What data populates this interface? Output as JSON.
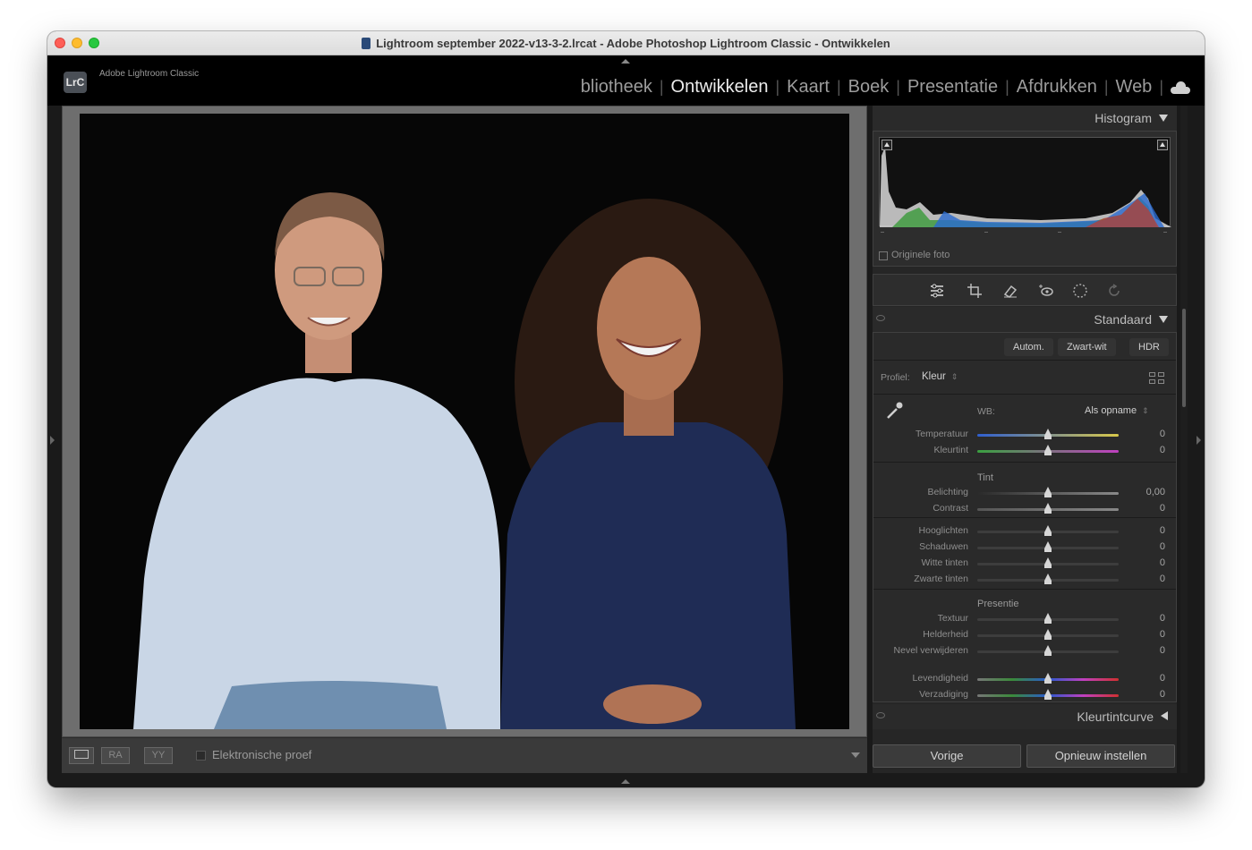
{
  "window": {
    "title": "Lightroom september 2022-v13-3-2.lrcat - Adobe Photoshop Lightroom Classic - Ontwikkelen"
  },
  "app": {
    "logo": "LrC",
    "name": "Adobe Lightroom Classic"
  },
  "modules": [
    {
      "label": "bliotheek",
      "active": false
    },
    {
      "label": "Ontwikkelen",
      "active": true
    },
    {
      "label": "Kaart",
      "active": false
    },
    {
      "label": "Boek",
      "active": false
    },
    {
      "label": "Presentatie",
      "active": false
    },
    {
      "label": "Afdrukken",
      "active": false
    },
    {
      "label": "Web",
      "active": false
    }
  ],
  "toolbar": {
    "view_btn_1": "RA",
    "view_btn_2": "YY",
    "soft_proof_label": "Elektronische proef"
  },
  "histogram": {
    "header": "Histogram",
    "original_photo_label": "Originele foto"
  },
  "basic": {
    "header": "Standaard",
    "buttons": [
      "Autom.",
      "Zwart-wit",
      "HDR"
    ],
    "profile_label": "Profiel:",
    "profile_value": "Kleur",
    "wb_label": "WB:",
    "wb_value": "Als opname",
    "wb_sliders": [
      {
        "label": "Temperatuur",
        "value": "0",
        "pos": 0.5
      },
      {
        "label": "Kleurtint",
        "value": "0",
        "pos": 0.5
      }
    ],
    "tone_title": "Tint",
    "tone_sliders": [
      {
        "label": "Belichting",
        "value": "0,00",
        "pos": 0.5
      },
      {
        "label": "Contrast",
        "value": "0",
        "pos": 0.5
      }
    ],
    "tone_sliders_2": [
      {
        "label": "Hooglichten",
        "value": "0",
        "pos": 0.5
      },
      {
        "label": "Schaduwen",
        "value": "0",
        "pos": 0.5
      },
      {
        "label": "Witte tinten",
        "value": "0",
        "pos": 0.5
      },
      {
        "label": "Zwarte tinten",
        "value": "0",
        "pos": 0.5
      }
    ],
    "presence_title": "Presentie",
    "presence_sliders": [
      {
        "label": "Textuur",
        "value": "0",
        "pos": 0.5
      },
      {
        "label": "Helderheid",
        "value": "0",
        "pos": 0.5
      },
      {
        "label": "Nevel verwijderen",
        "value": "0",
        "pos": 0.5
      }
    ],
    "presence_sliders_2": [
      {
        "label": "Levendigheid",
        "value": "0",
        "pos": 0.5
      },
      {
        "label": "Verzadiging",
        "value": "0",
        "pos": 0.5
      }
    ]
  },
  "tone_curve": {
    "header": "Kleurtintcurve"
  },
  "footer": {
    "previous": "Vorige",
    "reset": "Opnieuw instellen"
  }
}
